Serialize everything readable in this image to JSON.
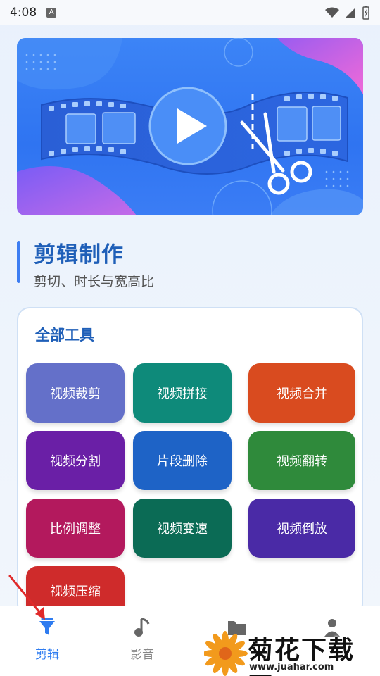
{
  "status_bar": {
    "time": "4:08",
    "notification_badge": "A"
  },
  "section": {
    "title": "剪辑制作",
    "subtitle": "剪切、时长与宽高比"
  },
  "tools": {
    "title": "全部工具",
    "items": [
      {
        "label": "视频裁剪",
        "color": "#6470c9"
      },
      {
        "label": "视频拼接",
        "color": "#0e8a7a"
      },
      {
        "label": "视频合并",
        "color": "#d94b1f"
      },
      {
        "label": "视频分割",
        "color": "#6a1fa6"
      },
      {
        "label": "片段删除",
        "color": "#1e63c6"
      },
      {
        "label": "视频翻转",
        "color": "#2f8a3b"
      },
      {
        "label": "比例调整",
        "color": "#b3195d"
      },
      {
        "label": "视频变速",
        "color": "#0b6b55"
      },
      {
        "label": "视频倒放",
        "color": "#4a2aa6"
      },
      {
        "label": "视频压缩",
        "color": "#cf2b2b"
      }
    ]
  },
  "bottom_nav": {
    "items": [
      {
        "label": "剪辑",
        "icon": "funnel-edit-icon",
        "active": true
      },
      {
        "label": "影音",
        "icon": "music-note-icon",
        "active": false
      },
      {
        "label": "",
        "icon": "folder-icon",
        "active": false
      },
      {
        "label": "",
        "icon": "person-icon",
        "active": false
      }
    ],
    "active_color": "#2f7cf0"
  },
  "watermark": {
    "title": "菊花下载网",
    "url": "www.juahar.com"
  },
  "colors": {
    "accent": "#3d7df2",
    "title_blue": "#1f5fb8",
    "banner_blue": "#3c84f6"
  }
}
